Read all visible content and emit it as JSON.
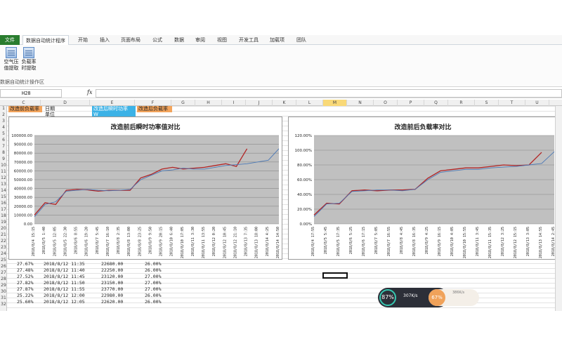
{
  "ribbon": {
    "tabs": [
      "文件",
      "数据自动统计程序",
      "开始",
      "插入",
      "页面布局",
      "公式",
      "数据",
      "审阅",
      "视图",
      "开发工具",
      "加载项",
      "团队"
    ],
    "buttons": [
      {
        "label1": "空气压",
        "label2": "值提取"
      },
      {
        "label1": "负载率",
        "label2": "时提取"
      }
    ],
    "group_label": "数据自动统计操作区"
  },
  "formula_bar": {
    "cell_ref": "H28",
    "fx": "fx"
  },
  "columns": [
    "C",
    "D",
    "E",
    "F",
    "G",
    "H",
    "I",
    "J",
    "K",
    "L",
    "M",
    "N",
    "O",
    "P",
    "Q",
    "R",
    "S",
    "T",
    "U"
  ],
  "selected_column": "M",
  "row_numbers": [
    "1",
    "2",
    "3",
    "4",
    "5",
    "6",
    "7",
    "8",
    "9",
    "10",
    "11",
    "12",
    "13",
    "14",
    "15",
    "16",
    "17",
    "18",
    "19",
    "20",
    "21",
    "22",
    "23",
    "24",
    "25",
    "26",
    "27",
    "28",
    "29",
    "30",
    "31",
    "32"
  ],
  "header_cells": {
    "c1": "改造前负载率",
    "d1": "日期",
    "d2": "单位",
    "e1": "改造后瞬时功率",
    "e2": "W",
    "f1": "改造后负载率"
  },
  "data_rows": [
    {
      "c": "27.67%",
      "d": "2018/8/12 11:35",
      "e": "22680.00",
      "f": "26.00%"
    },
    {
      "c": "27.48%",
      "d": "2018/8/12 11:40",
      "e": "22250.00",
      "f": "26.00%"
    },
    {
      "c": "27.52%",
      "d": "2018/8/12 11:45",
      "e": "23120.00",
      "f": "27.00%"
    },
    {
      "c": "27.82%",
      "d": "2018/8/12 11:50",
      "e": "23150.00",
      "f": "27.00%"
    },
    {
      "c": "27.87%",
      "d": "2018/8/12 11:55",
      "e": "23770.00",
      "f": "27.00%"
    },
    {
      "c": "25.22%",
      "d": "2018/8/12 12:00",
      "e": "22980.00",
      "f": "26.00%"
    },
    {
      "c": "25.60%",
      "d": "2018/8/12 12:05",
      "e": "22620.00",
      "f": "26.00%"
    }
  ],
  "chart_data": [
    {
      "type": "line",
      "title": "改造前后瞬时功率值对比",
      "ylim": [
        0,
        100000
      ],
      "yticks": [
        "0.00",
        "10000.00",
        "20000.00",
        "30000.00",
        "40000.00",
        "50000.00",
        "60000.00",
        "70000.00",
        "80000.00",
        "90000.00",
        "100000.00"
      ],
      "categories": [
        "2018/8/4 15:15",
        "2018/8/5 1:40",
        "2018/8/5 12:05",
        "2018/8/5 22:30",
        "2018/8/6 8:55",
        "2018/8/6 19:20",
        "2018/8/7 5:45",
        "2018/8/7 16:10",
        "2018/8/8 2:35",
        "2018/8/8 13:00",
        "2018/8/8 23:25",
        "2018/8/9 9:50",
        "2018/8/9 20:15",
        "2018/8/10 6:40",
        "2018/8/10 17:05",
        "2018/8/11 3:30",
        "2018/8/11 13:55",
        "2018/8/12 0:20",
        "2018/8/12 10:45",
        "2018/8/12 21:10",
        "2018/8/13 7:35",
        "2018/8/13 18:00",
        "2018/8/14 4:25",
        "2018/8/14 14:50"
      ],
      "series": [
        {
          "color": "#b22424",
          "values": [
            10000,
            24000,
            22000,
            38000,
            39000,
            38500,
            37000,
            38000,
            38000,
            38000,
            52000,
            56000,
            62000,
            64000,
            62000,
            63000,
            64000,
            66000,
            68000,
            65000,
            85000,
            null,
            null,
            null
          ]
        },
        {
          "color": "#4a78b6",
          "values": [
            8000,
            22000,
            25000,
            37000,
            38000,
            39000,
            38000,
            37500,
            38000,
            39000,
            50000,
            55000,
            60000,
            61000,
            63000,
            62000,
            62000,
            64000,
            66000,
            67000,
            68000,
            70000,
            72000,
            85000
          ]
        }
      ]
    },
    {
      "type": "line",
      "title": "改造前后负载率对比",
      "ylim": [
        0,
        1.2
      ],
      "yticks": [
        "0.00%",
        "20.00%",
        "40.00%",
        "60.00%",
        "80.00%",
        "100.00%",
        "120.00%"
      ],
      "categories": [
        "2018/8/4 17:55",
        "2018/8/5 5:45",
        "2018/8/5 17:35",
        "2018/8/6 5:25",
        "2018/8/6 17:15",
        "2018/8/7 5:05",
        "2018/8/7 16:55",
        "2018/8/8 4:45",
        "2018/8/8 16:35",
        "2018/8/9 4:25",
        "2018/8/9 16:15",
        "2018/8/10 4:05",
        "2018/8/10 15:55",
        "2018/8/11 3:45",
        "2018/8/11 15:35",
        "2018/8/12 3:25",
        "2018/8/12 15:15",
        "2018/8/13 3:05",
        "2018/8/13 14:55",
        "2018/8/14 2:45"
      ],
      "series": [
        {
          "color": "#b22424",
          "values": [
            0.12,
            0.28,
            0.27,
            0.45,
            0.46,
            0.45,
            0.46,
            0.46,
            0.47,
            0.62,
            0.72,
            0.74,
            0.76,
            0.76,
            0.78,
            0.8,
            0.79,
            0.8,
            0.97,
            null
          ]
        },
        {
          "color": "#4a78b6",
          "values": [
            0.1,
            0.27,
            0.28,
            0.44,
            0.45,
            0.46,
            0.46,
            0.45,
            0.47,
            0.6,
            0.7,
            0.72,
            0.74,
            0.74,
            0.76,
            0.77,
            0.78,
            0.8,
            0.82,
            0.98
          ]
        }
      ]
    }
  ],
  "widget": {
    "cpu": "87%",
    "speed": "307K/s",
    "cpu2": "67%",
    "speed2": "386K/s"
  }
}
